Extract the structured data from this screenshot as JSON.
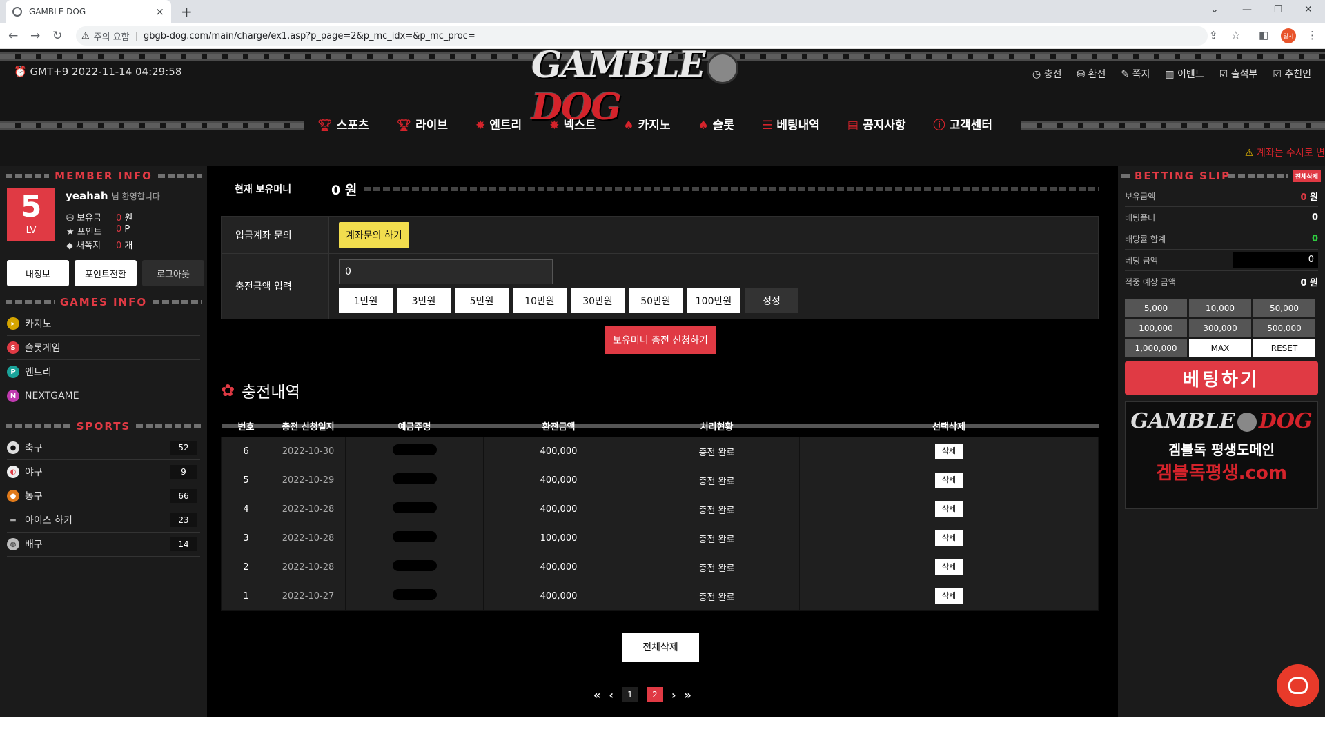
{
  "browser": {
    "tab_title": "GAMBLE DOG",
    "insecure_label": "주의 요함",
    "url": "gbgb-dog.com/main/charge/ex1.asp?p_page=2&p_mc_idx=&p_mc_proc=",
    "profile_label": "일시"
  },
  "header": {
    "clock": "GMT+9 2022-11-14 04:29:58",
    "logo_left": "GAMBLE",
    "logo_right": "DOG",
    "top_links": [
      "충전",
      "환전",
      "쪽지",
      "이벤트",
      "출석부",
      "추천인"
    ],
    "nav": [
      "스포츠",
      "라이브",
      "엔트리",
      "넥스트",
      "카지노",
      "슬롯",
      "베팅내역",
      "공지사항",
      "고객센터"
    ],
    "notice": "계좌는 수시로 변"
  },
  "member": {
    "title": "MEMBER INFO",
    "level": "5",
    "level_label": "LV",
    "username": "yeahah",
    "welcome": "님 환영합니다",
    "stats": [
      {
        "label": "보유금",
        "value": "0",
        "unit": "원"
      },
      {
        "label": "포인트",
        "value": "0",
        "unit": "P"
      },
      {
        "label": "새쪽지",
        "value": "0",
        "unit": "개"
      }
    ],
    "buttons": [
      "내정보",
      "포인트전환",
      "로그아웃"
    ]
  },
  "games": {
    "title": "GAMES INFO",
    "items": [
      "카지노",
      "슬롯게임",
      "엔트리",
      "NEXTGAME"
    ]
  },
  "sports": {
    "title": "SPORTS",
    "items": [
      {
        "name": "축구",
        "count": "52"
      },
      {
        "name": "야구",
        "count": "9"
      },
      {
        "name": "농구",
        "count": "66"
      },
      {
        "name": "아이스 하키",
        "count": "23"
      },
      {
        "name": "배구",
        "count": "14"
      }
    ]
  },
  "charge": {
    "money_label": "현재 보유머니",
    "money_value": "0 원",
    "inquiry_label": "입금계좌 문의",
    "inquiry_button": "계좌문의 하기",
    "amount_label": "충전금액 입력",
    "amount_value": "0",
    "amount_buttons": [
      "1만원",
      "3만원",
      "5만원",
      "10만원",
      "30만원",
      "50만원",
      "100만원"
    ],
    "reset_button": "정정",
    "submit_button": "보유머니 충전 신청하기"
  },
  "history": {
    "title": "충전내역",
    "columns": [
      "번호",
      "충전 신청일지",
      "예금주명",
      "환전금액",
      "처리현황",
      "선택삭제"
    ],
    "rows": [
      {
        "no": "6",
        "date": "2022-10-30",
        "amount": "400,000",
        "status": "충전 완료",
        "action": "삭제"
      },
      {
        "no": "5",
        "date": "2022-10-29",
        "amount": "400,000",
        "status": "충전 완료",
        "action": "삭제"
      },
      {
        "no": "4",
        "date": "2022-10-28",
        "amount": "400,000",
        "status": "충전 완료",
        "action": "삭제"
      },
      {
        "no": "3",
        "date": "2022-10-28",
        "amount": "100,000",
        "status": "충전 완료",
        "action": "삭제"
      },
      {
        "no": "2",
        "date": "2022-10-28",
        "amount": "400,000",
        "status": "충전 완료",
        "action": "삭제"
      },
      {
        "no": "1",
        "date": "2022-10-27",
        "amount": "400,000",
        "status": "충전 완료",
        "action": "삭제"
      }
    ],
    "delete_all": "전체삭제",
    "pages": [
      "1",
      "2"
    ],
    "current_page": "2"
  },
  "slip": {
    "title": "BETTING SLIP",
    "clear_all": "전체삭제",
    "rows": [
      {
        "label": "보유금액",
        "value": "0",
        "unit": "원"
      },
      {
        "label": "베팅폴더",
        "value": "0"
      },
      {
        "label": "배당률 합계",
        "value": "0"
      },
      {
        "label": "베팅 금액",
        "value": "0"
      },
      {
        "label": "적중 예상 금액",
        "value": "0",
        "unit": "원"
      }
    ],
    "amount_buttons": [
      "5,000",
      "10,000",
      "50,000",
      "100,000",
      "300,000",
      "500,000",
      "1,000,000",
      "MAX",
      "RESET"
    ],
    "bet_button": "베팅하기",
    "banner_logo_left": "GAMBLE",
    "banner_logo_right": "DOG",
    "banner_line1": "겜블독 평생도메인",
    "banner_line2": "겜블독평생.com"
  },
  "colors": {
    "accent": "#e03a44",
    "yellow": "#f2dd4e",
    "bg": "#151515"
  }
}
